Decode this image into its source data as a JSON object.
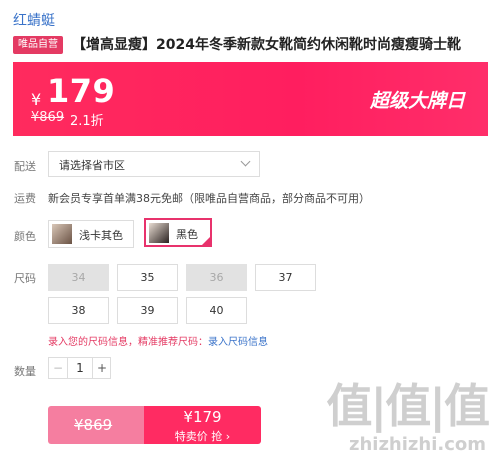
{
  "brand": "红蜻蜓",
  "product": {
    "tag": "唯品自营",
    "title": "【增高显瘦】2024年冬季新款女靴简约休闲靴时尚瘦瘦骑士靴"
  },
  "price_banner": {
    "currency": "¥",
    "price": "179",
    "original_price": "¥869",
    "discount": "2.1折",
    "promo": "超级大牌日"
  },
  "delivery": {
    "label": "配送",
    "placeholder": "请选择省市区"
  },
  "shipping": {
    "label": "运费",
    "text": "新会员专享首单满38元免邮（限唯品自营商品，部分商品不可用）"
  },
  "color": {
    "label": "颜色",
    "options": [
      {
        "name": "浅卡其色",
        "selected": false
      },
      {
        "name": "黑色",
        "selected": true
      }
    ]
  },
  "size": {
    "label": "尺码",
    "options": [
      {
        "value": "34",
        "available": false
      },
      {
        "value": "35",
        "available": true
      },
      {
        "value": "36",
        "available": false
      },
      {
        "value": "37",
        "available": true
      },
      {
        "value": "38",
        "available": true
      },
      {
        "value": "39",
        "available": true
      },
      {
        "value": "40",
        "available": true
      }
    ],
    "notice_text": "录入您的尺码信息，精准推荐尺码：",
    "notice_link": "录入尺码信息"
  },
  "quantity": {
    "label": "数量",
    "value": "1",
    "minus": "−",
    "plus": "+"
  },
  "buy": {
    "original": "¥869",
    "price": "¥179",
    "action": "特卖价 抢 ›"
  },
  "watermark": {
    "logo": "值|值|值",
    "url": "zhizhizhi.com"
  },
  "colors": {
    "accent": "#ff2b62",
    "link": "#3a73c9",
    "disabled": "#e2e2e2"
  }
}
